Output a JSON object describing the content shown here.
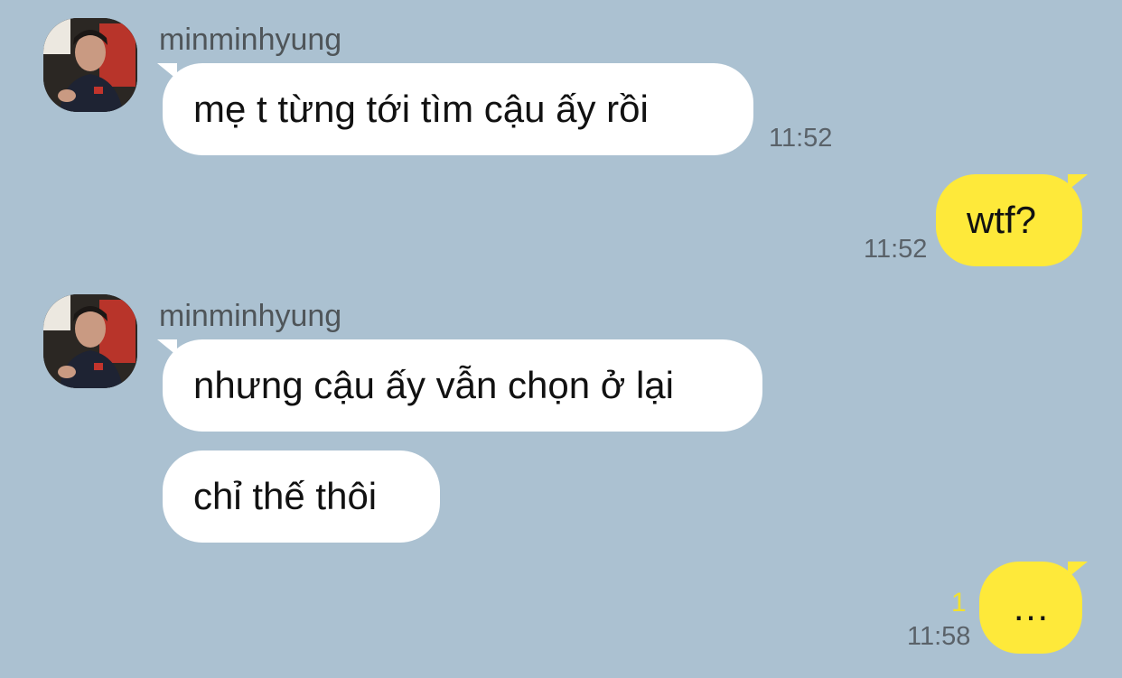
{
  "chat": {
    "messages": [
      {
        "sender": "minminhyung",
        "text": "mẹ t từng tới tìm cậu ấy rồi",
        "time": "11:52"
      },
      {
        "text": "wtf?",
        "time": "11:52"
      },
      {
        "sender": "minminhyung",
        "text": "nhưng cậu ấy vẫn chọn ở lại"
      },
      {
        "text": "chỉ thế thôi"
      },
      {
        "text": "…",
        "time": "11:58",
        "unread_count": "1"
      }
    ]
  },
  "colors": {
    "background": "#abc1d1",
    "incoming_bubble": "#ffffff",
    "outgoing_bubble": "#fee93a",
    "unread_count": "#f3e12d"
  },
  "icons": {
    "avatar": "profile-photo-icon"
  }
}
